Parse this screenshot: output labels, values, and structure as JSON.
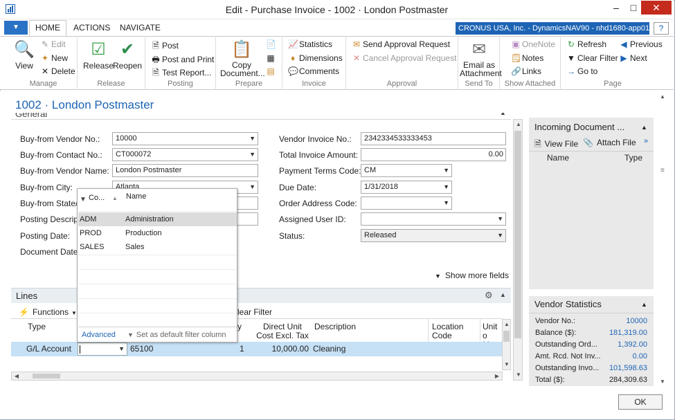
{
  "window": {
    "title": "Edit - Purchase Invoice - 1002 · London Postmaster",
    "minimize": "–",
    "maximize": "□",
    "close": "✕"
  },
  "ribbon_tabs": {
    "home": "HOME",
    "actions": "ACTIONS",
    "navigate": "NAVIGATE"
  },
  "company": "CRONUS USA, Inc. - DynamicsNAV90 - nhd1680-app01.nh...",
  "help": "?",
  "manage": {
    "label": "Manage",
    "view": "View",
    "edit": "Edit",
    "new": "New",
    "delete": "Delete"
  },
  "release": {
    "label": "Release",
    "release": "Release",
    "reopen": "Reopen"
  },
  "posting": {
    "label": "Posting",
    "post": "Post",
    "post_print": "Post and Print",
    "test_report": "Test Report..."
  },
  "prepare": {
    "label": "Prepare",
    "copy_document": "Copy Document..."
  },
  "invoice": {
    "label": "Invoice",
    "statistics": "Statistics",
    "dimensions": "Dimensions",
    "comments": "Comments"
  },
  "approval": {
    "label": "Approval",
    "send": "Send Approval Request",
    "cancel": "Cancel Approval Request"
  },
  "sendto": {
    "label": "Send To",
    "email": "Email as Attachment"
  },
  "show_attached": {
    "label": "Show Attached",
    "onenote": "OneNote",
    "notes": "Notes",
    "links": "Links"
  },
  "page": {
    "label": "Page",
    "refresh": "Refresh",
    "clear_filter": "Clear Filter",
    "goto": "Go to",
    "previous": "Previous",
    "next": "Next"
  },
  "page_title": "1002 · London Postmaster",
  "general": {
    "section": "General",
    "vendor_no_label": "Buy-from Vendor No.:",
    "vendor_no": "10000",
    "contact_no_label": "Buy-from Contact No.:",
    "contact_no": "CT000072",
    "vendor_name_label": "Buy-from Vendor Name:",
    "vendor_name": "London Postmaster",
    "city_label": "Buy-from City:",
    "city": "Atlanta",
    "state_label": "Buy-from State/Z",
    "posting_desc_label": "Posting Descripti",
    "posting_date_label": "Posting Date:",
    "document_date_label": "Document Date:",
    "vendor_invoice_label": "Vendor Invoice No.:",
    "vendor_invoice": "2342334533333453",
    "total_label": "Total Invoice Amount:",
    "total": "0.00",
    "payment_terms_label": "Payment Terms Code:",
    "payment_terms": "CM",
    "due_date_label": "Due Date:",
    "due_date": "1/31/2018",
    "order_address_label": "Order Address Code:",
    "assigned_user_label": "Assigned User ID:",
    "status_label": "Status:",
    "status": "Released",
    "show_more": "Show more fields"
  },
  "dropdown": {
    "col_code": "Co...",
    "col_name": "Name",
    "rows": [
      {
        "code": "ADM",
        "name": "Administration"
      },
      {
        "code": "PROD",
        "name": "Production"
      },
      {
        "code": "SALES",
        "name": "Sales"
      }
    ],
    "advanced": "Advanced",
    "set_default": "Set as default filter column"
  },
  "lines": {
    "title": "Lines",
    "functions": "Functions",
    "clear_filter": "lear Filter",
    "col_type": "Type",
    "col_qty": "y",
    "col_unit_cost": "Direct Unit Cost Excl. Tax",
    "col_description": "Description",
    "col_location": "Location Code",
    "col_uom": "Unit o Meas",
    "row": {
      "type": "G/L Account",
      "no": "65100",
      "qty": "1",
      "unit_cost": "10,000.00",
      "description": "Cleaning"
    }
  },
  "incoming": {
    "title": "Incoming Document ...",
    "view_file": "View File",
    "attach_file": "Attach File",
    "col_name": "Name",
    "col_type": "Type"
  },
  "vendor_stats": {
    "title": "Vendor Statistics",
    "rows": [
      {
        "label": "Vendor No.:",
        "value": "10000"
      },
      {
        "label": "Balance ($):",
        "value": "181,319.00"
      },
      {
        "label": "Outstanding Ord...",
        "value": "1,392.00"
      },
      {
        "label": "Amt. Rcd. Not Inv...",
        "value": "0.00"
      },
      {
        "label": "Outstanding Invo...",
        "value": "101,598.63"
      },
      {
        "label": "Total ($):",
        "value": "284,309.63"
      }
    ]
  },
  "ok": "OK"
}
